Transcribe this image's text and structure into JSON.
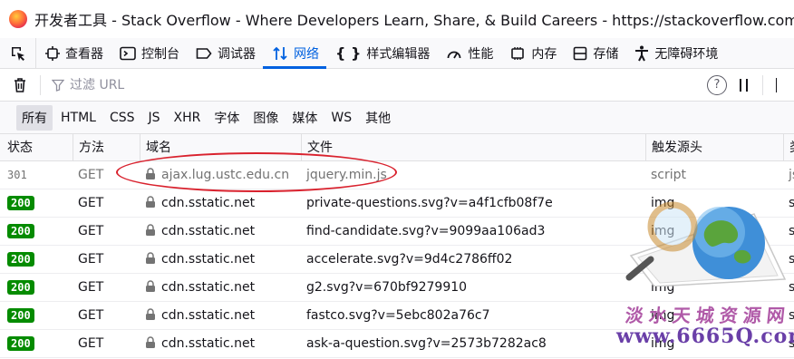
{
  "window": {
    "title": "开发者工具 - Stack Overflow - Where Developers Learn, Share, & Build Careers - https://stackoverflow.com/"
  },
  "toolbar": {
    "tabs": [
      {
        "label": "查看器",
        "icon": "inspector-icon"
      },
      {
        "label": "控制台",
        "icon": "console-icon"
      },
      {
        "label": "调试器",
        "icon": "debugger-icon"
      },
      {
        "label": "网络",
        "icon": "network-icon",
        "selected": true
      },
      {
        "label": "样式编辑器",
        "icon": "style-editor-icon"
      },
      {
        "label": "性能",
        "icon": "performance-icon"
      },
      {
        "label": "内存",
        "icon": "memory-icon"
      },
      {
        "label": "存储",
        "icon": "storage-icon"
      },
      {
        "label": "无障碍环境",
        "icon": "accessibility-icon"
      }
    ]
  },
  "filterbar": {
    "placeholder": "过滤 URL"
  },
  "request_types": [
    "所有",
    "HTML",
    "CSS",
    "JS",
    "XHR",
    "字体",
    "图像",
    "媒体",
    "WS",
    "其他"
  ],
  "table": {
    "columns": [
      "状态",
      "方法",
      "域名",
      "文件",
      "触发源头",
      "类"
    ],
    "rows": [
      {
        "status": "301",
        "method": "GET",
        "domain": "ajax.lug.ustc.edu.cn",
        "file": "jquery.min.js",
        "cause": "script",
        "type": "js"
      },
      {
        "status": "200",
        "method": "GET",
        "domain": "cdn.sstatic.net",
        "file": "private-questions.svg?v=a4f1cfb08f7e",
        "cause": "img",
        "type": "s"
      },
      {
        "status": "200",
        "method": "GET",
        "domain": "cdn.sstatic.net",
        "file": "find-candidate.svg?v=9099aa106ad3",
        "cause": "img",
        "type": "s"
      },
      {
        "status": "200",
        "method": "GET",
        "domain": "cdn.sstatic.net",
        "file": "accelerate.svg?v=9d4c2786ff02",
        "cause": "img",
        "type": "s"
      },
      {
        "status": "200",
        "method": "GET",
        "domain": "cdn.sstatic.net",
        "file": "g2.svg?v=670bf9279910",
        "cause": "img",
        "type": "s"
      },
      {
        "status": "200",
        "method": "GET",
        "domain": "cdn.sstatic.net",
        "file": "fastco.svg?v=5ebc802a76c7",
        "cause": "img",
        "type": "s"
      },
      {
        "status": "200",
        "method": "GET",
        "domain": "cdn.sstatic.net",
        "file": "ask-a-question.svg?v=2573b7282ac8",
        "cause": "img",
        "type": "s"
      }
    ]
  },
  "watermark": {
    "text": "淡水天城资源网",
    "url": "www.6665Q.com"
  },
  "colors": {
    "accent": "#0061e0",
    "status_ok": "#058b00",
    "annotation": "#d9222e"
  }
}
